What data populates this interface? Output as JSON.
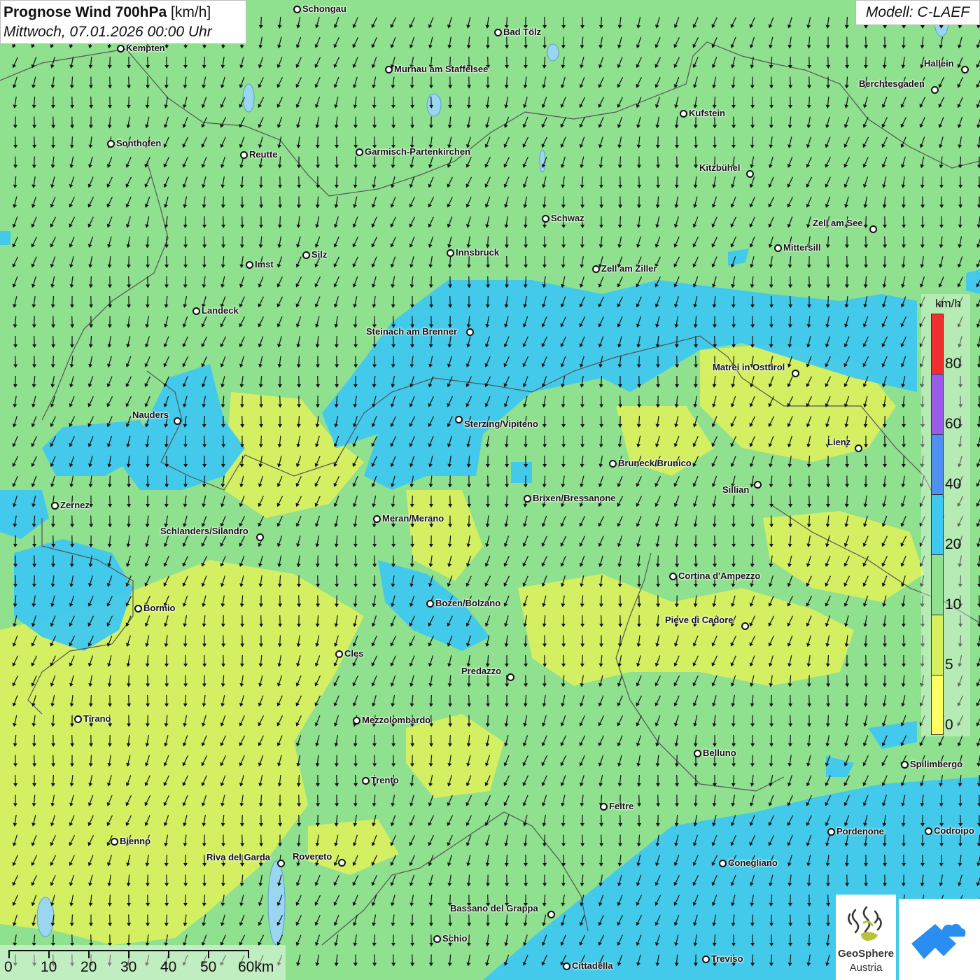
{
  "header": {
    "title_bold": "Prognose Wind 700hPa",
    "title_unit": "[km/h]",
    "date": "Mittwoch, 07.01.2026 00:00 Uhr"
  },
  "model_label": "Modell: C-LAEF",
  "legend": {
    "unit": "km/h",
    "classes": [
      {
        "from": 0,
        "to": 5,
        "color": "#ffff66"
      },
      {
        "from": 5,
        "to": 10,
        "color": "#d8f060"
      },
      {
        "from": 10,
        "to": 20,
        "color": "#8fe08f"
      },
      {
        "from": 20,
        "to": 40,
        "color": "#3fc8f0"
      },
      {
        "from": 40,
        "to": 60,
        "color": "#5090f0"
      },
      {
        "from": 60,
        "to": 80,
        "color": "#9a5ce8"
      },
      {
        "from": 80,
        "to": null,
        "color": "#f03030"
      }
    ],
    "labels": [
      "80",
      "60",
      "40",
      "20",
      "10",
      "5",
      "0"
    ]
  },
  "scale_bar": {
    "labels": [
      "0",
      "10",
      "20",
      "30",
      "40",
      "50",
      "60km"
    ]
  },
  "logos": {
    "geosphere_name": "GeoSphere",
    "geosphere_sub": "Austria"
  },
  "cities": [
    "Schongau",
    "Bad Tölz",
    "Kempten",
    "Murnau am Staffelsee",
    "Hallein",
    "Berchtesgaden",
    "Kufstein",
    "Sonthofen",
    "Reutte",
    "Garmisch-Partenkirchen",
    "Kitzbühel",
    "Schwaz",
    "Zell am See",
    "Mittersill",
    "Innsbruck",
    "Silz",
    "Imst",
    "Zell am Ziller",
    "Landeck",
    "Steinach am Brenner",
    "Matrei in Osttirol",
    "Nauders",
    "Sterzing/Vipiteno",
    "Lienz",
    "Bruneck/Brunico",
    "Sillian",
    "Zernez",
    "Brixen/Bressanone",
    "Meran/Merano",
    "Schlanders/Silandro",
    "Cortina d'Ampezzo",
    "Bozen/Bolzano",
    "Bormio",
    "Pieve di Cadore",
    "Cles",
    "Predazzo",
    "Tirano",
    "Mezzolombardo",
    "Belluno",
    "Spilimbergo",
    "Trento",
    "Feltre",
    "Pordenone",
    "Codroipo",
    "Bienno",
    "Riva del Garda",
    "Rovereto",
    "Conegliano",
    "Bassano del Grappa",
    "Schio",
    "Treviso",
    "Cittadella"
  ],
  "wind_field": {
    "speed_class": "10-20",
    "direction": "from north-northwest"
  }
}
